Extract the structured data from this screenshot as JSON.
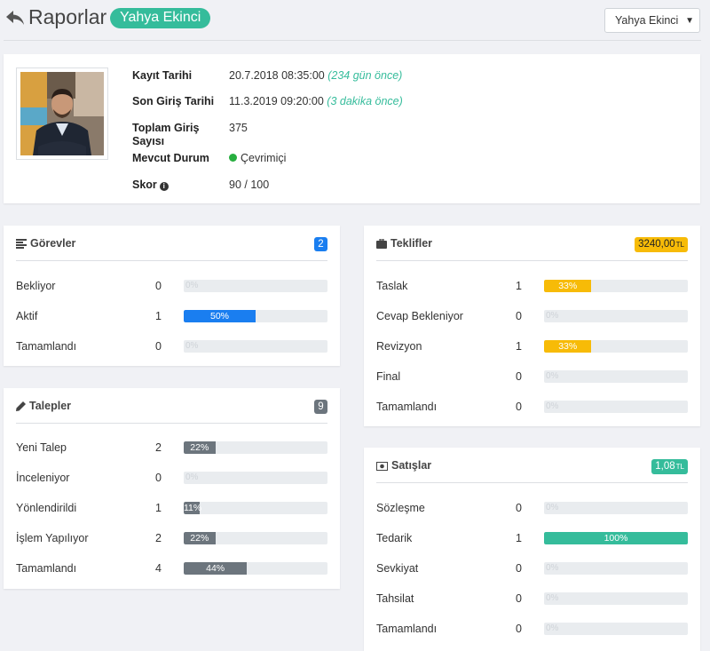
{
  "header": {
    "title": "Raporlar",
    "user_badge": "Yahya Ekinci",
    "user_select": "Yahya Ekinci"
  },
  "profile": {
    "rows": [
      {
        "label": "Kayıt Tarihi",
        "value": "20.7.2018 08:35:00",
        "ago": "(234 gün önce)"
      },
      {
        "label": "Son Giriş Tarihi",
        "value": "11.3.2019 09:20:00",
        "ago": "(3 dakika önce)"
      },
      {
        "label": "Toplam Giriş Sayısı",
        "value": "375"
      },
      {
        "label": "Mevcut Durum",
        "value": "Çevrimiçi"
      },
      {
        "label": "Skor",
        "value": "90 / 100"
      }
    ],
    "status_color": "#27ae3f"
  },
  "panels": {
    "gorevler": {
      "title": "Görevler",
      "badge": "2",
      "badge_color": "#1a7ef0",
      "rows": [
        {
          "label": "Bekliyor",
          "count": "0",
          "percent": 0,
          "percent_label": "0%"
        },
        {
          "label": "Aktif",
          "count": "1",
          "percent": 50,
          "percent_label": "50%"
        },
        {
          "label": "Tamamlandı",
          "count": "0",
          "percent": 0,
          "percent_label": "0%"
        }
      ],
      "bar_color": "#1a7ef0"
    },
    "talepler": {
      "title": "Talepler",
      "badge": "9",
      "badge_color": "#6c757d",
      "rows": [
        {
          "label": "Yeni Talep",
          "count": "2",
          "percent": 22,
          "percent_label": "22%"
        },
        {
          "label": "İnceleniyor",
          "count": "0",
          "percent": 0,
          "percent_label": "0%"
        },
        {
          "label": "Yönlendirildi",
          "count": "1",
          "percent": 11,
          "percent_label": "11%"
        },
        {
          "label": "İşlem Yapılıyor",
          "count": "2",
          "percent": 22,
          "percent_label": "22%"
        },
        {
          "label": "Tamamlandı",
          "count": "4",
          "percent": 44,
          "percent_label": "44%"
        }
      ],
      "bar_color": "#6c757d"
    },
    "teklifler": {
      "title": "Teklifler",
      "badge": "3240,00",
      "badge_unit": "TL",
      "badge_color": "#f7bb07",
      "rows": [
        {
          "label": "Taslak",
          "count": "1",
          "percent": 33,
          "percent_label": "33%"
        },
        {
          "label": "Cevap Bekleniyor",
          "count": "0",
          "percent": 0,
          "percent_label": "0%"
        },
        {
          "label": "Revizyon",
          "count": "1",
          "percent": 33,
          "percent_label": "33%"
        },
        {
          "label": "Final",
          "count": "0",
          "percent": 0,
          "percent_label": "0%"
        },
        {
          "label": "Tamamlandı",
          "count": "0",
          "percent": 0,
          "percent_label": "0%"
        }
      ],
      "bar_color": "#f7bb07"
    },
    "satislar": {
      "title": "Satışlar",
      "badge": "1,08",
      "badge_unit": "TL",
      "badge_color": "#35bc9b",
      "rows": [
        {
          "label": "Sözleşme",
          "count": "0",
          "percent": 0,
          "percent_label": "0%"
        },
        {
          "label": "Tedarik",
          "count": "1",
          "percent": 100,
          "percent_label": "100%"
        },
        {
          "label": "Sevkiyat",
          "count": "0",
          "percent": 0,
          "percent_label": "0%"
        },
        {
          "label": "Tahsilat",
          "count": "0",
          "percent": 0,
          "percent_label": "0%"
        },
        {
          "label": "Tamamlandı",
          "count": "0",
          "percent": 0,
          "percent_label": "0%"
        }
      ],
      "bar_color": "#35bc9b"
    }
  }
}
